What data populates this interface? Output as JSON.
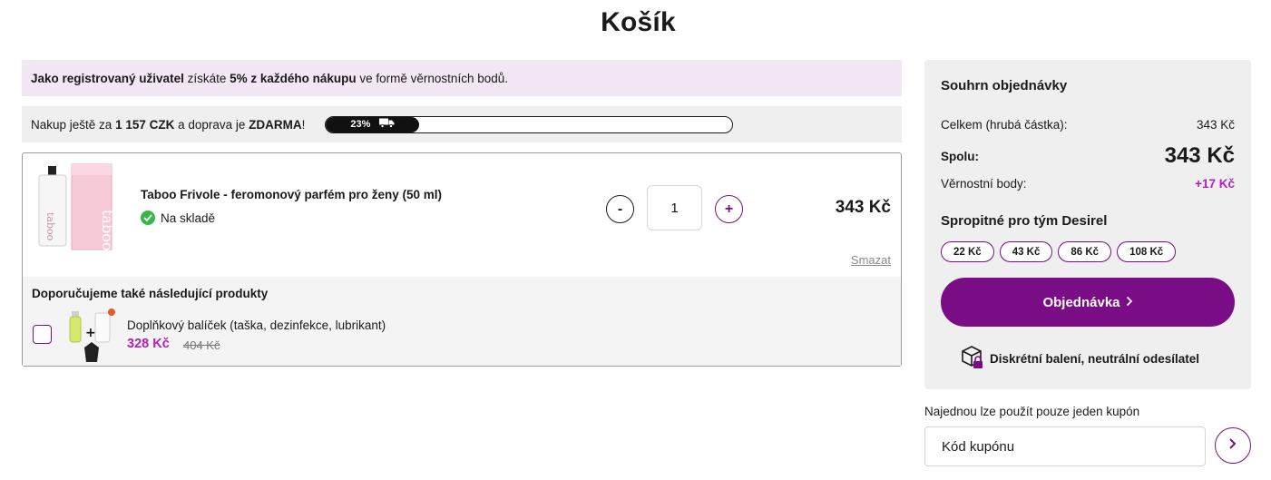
{
  "page": {
    "title": "Košík"
  },
  "loyalty": {
    "part1": "Jako registrovaný uživatel",
    "part2": " získáte ",
    "part3": "5% z každého nákupu",
    "part4": " ve formě věrnostních bodů."
  },
  "shipping": {
    "part1": "Nakup ještě za ",
    "amount": "1 157 CZK",
    "part2": " a doprava je ",
    "free": "ZDARMA",
    "part3": "!",
    "progress_percent": 23,
    "progress_label": "23%"
  },
  "cart": {
    "item": {
      "name": "Taboo Frivole - feromonový parfém pro ženy (50 ml)",
      "stock": "Na skladě",
      "quantity": "1",
      "minus": "-",
      "plus": "+",
      "price": "343 Kč",
      "delete": "Smazat"
    },
    "recommend": {
      "title": "Doporučujeme také následující produkty",
      "name": "Doplňkový balíček (taška, dezinfekce, lubrikant)",
      "price": "328 Kč",
      "old_price": "404 Kč"
    }
  },
  "summary": {
    "title": "Souhrn objednávky",
    "gross_label": "Celkem (hrubá částka):",
    "gross_value": "343 Kč",
    "total_label": "Spolu:",
    "total_value": "343 Kč",
    "points_label": "Věrnostní body:",
    "points_value": "+17 Kč",
    "tip_title": "Spropitné pro tým Desirel",
    "tips": [
      "22 Kč",
      "43 Kč",
      "86 Kč",
      "108 Kč"
    ],
    "order_button": "Objednávka",
    "discreet": "Diskrétní balení, neutrální odesílatel"
  },
  "coupon": {
    "note": "Najednou lze použít pouze jeden kupón",
    "placeholder": "Kód kupónu"
  },
  "colors": {
    "accent": "#7a0d86",
    "highlight": "#b21fbd",
    "banner": "#f3e6f5",
    "success": "#3bb54a"
  },
  "icons": [
    "truck-icon",
    "check-icon",
    "chevron-right-icon",
    "package-lock-icon"
  ]
}
